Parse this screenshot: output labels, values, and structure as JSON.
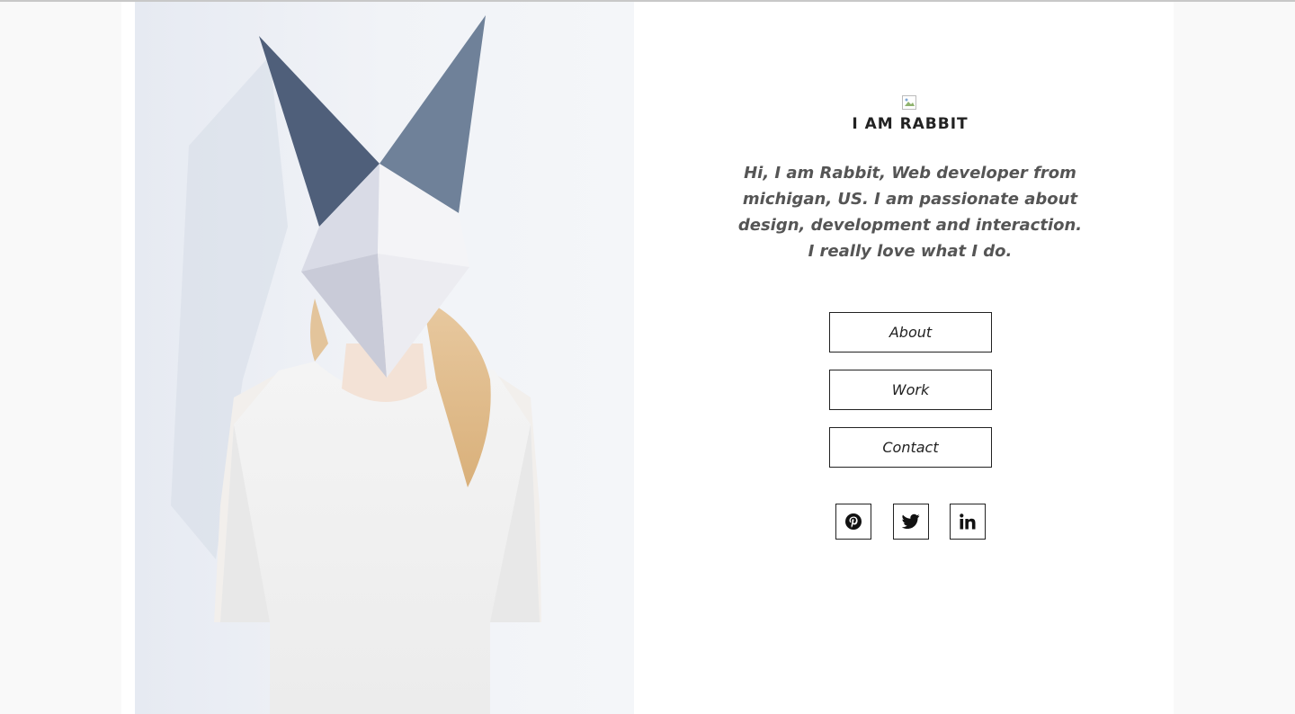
{
  "site": {
    "title": "I AM RABBIT",
    "intro": "Hi, I am Rabbit, Web developer from michigan, US. I am passionate about design, development and interaction. I really love what I do."
  },
  "nav": [
    {
      "label": "About"
    },
    {
      "label": "Work"
    },
    {
      "label": "Contact"
    }
  ],
  "social": [
    {
      "icon": "pinterest-icon"
    },
    {
      "icon": "twitter-icon"
    },
    {
      "icon": "linkedin-icon"
    }
  ],
  "colors": {
    "page_background": "#ffffff",
    "outer_background": "#f9f9f9",
    "text_dark": "#222222",
    "text_muted": "#555555"
  }
}
